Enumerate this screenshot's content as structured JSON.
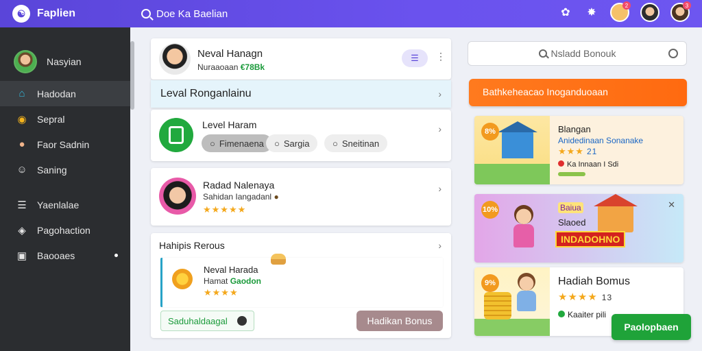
{
  "app": {
    "title": "Faplien"
  },
  "top_search": {
    "text": "Doe Ka Baelian"
  },
  "top_icons": [
    {
      "icon": "puzzle-icon"
    },
    {
      "icon": "gear-icon"
    },
    {
      "icon": "notification-avatar-icon",
      "badge": "2"
    },
    {
      "icon": "user-avatar-icon"
    },
    {
      "icon": "profile-avatar-icon",
      "badge": "3"
    }
  ],
  "sidebar": {
    "user_name": "Nasyian",
    "items": [
      {
        "label": "Hadodan",
        "icon": "home-icon",
        "active": true
      },
      {
        "label": "Sepral",
        "icon": "coin-icon"
      },
      {
        "label": "Faor Sadnin",
        "icon": "person-icon"
      },
      {
        "label": "Saning",
        "icon": "settings-icon"
      },
      {
        "label": "Yaenlalae",
        "icon": "list-icon"
      },
      {
        "label": "Pagohaction",
        "icon": "tag-icon"
      },
      {
        "label": "Baooaes",
        "icon": "box-icon"
      }
    ]
  },
  "profile_card": {
    "name": "Neval Hanagn",
    "subtitle": "Nuraaoaan",
    "subtitle_value": "€78Bk"
  },
  "level_bar": {
    "title": "Leval Ronganlainu"
  },
  "level_card": {
    "title": "Level Haram",
    "chips": [
      "Fimenaena",
      "Sargia",
      "Sneitinan"
    ]
  },
  "person_card": {
    "name": "Radad Nalenaya",
    "subtitle": "Sahidan Iangadanl",
    "rating": 4.5
  },
  "bonus_card": {
    "title": "Hahipis Rerous",
    "item_title": "Neval Harada",
    "item_sub": "Hamat",
    "item_sub_value": "Gaodon",
    "rating": 4,
    "left_button": "Saduhaldaagal",
    "right_button": "Hadikan Bonus"
  },
  "right_search": {
    "placeholder": "Nsladd Bonouk"
  },
  "orange_banner": {
    "text": "Bathkeheacao Inoganduoaan"
  },
  "rcard1": {
    "badge": "8%",
    "title": "Blangan",
    "subtitle": "Anidedinaan Sonanake",
    "rating_text": "21",
    "line": "Ka Innaan I Sdi",
    "rating": 3
  },
  "rcard2": {
    "badge": "10%",
    "tag": "Baiua",
    "title": "Slaoed",
    "banner": "INDADOHNO"
  },
  "rcard3": {
    "badge": "9%",
    "title": "Hadiah Bomus",
    "rating_text": "13",
    "line": "Kaaiter pili",
    "rating": 4
  },
  "green_button": {
    "label": "Paolopbaen"
  },
  "colors": {
    "accent": "#5a45d9",
    "orange": "#ff7a1e",
    "green": "#1fa339"
  }
}
